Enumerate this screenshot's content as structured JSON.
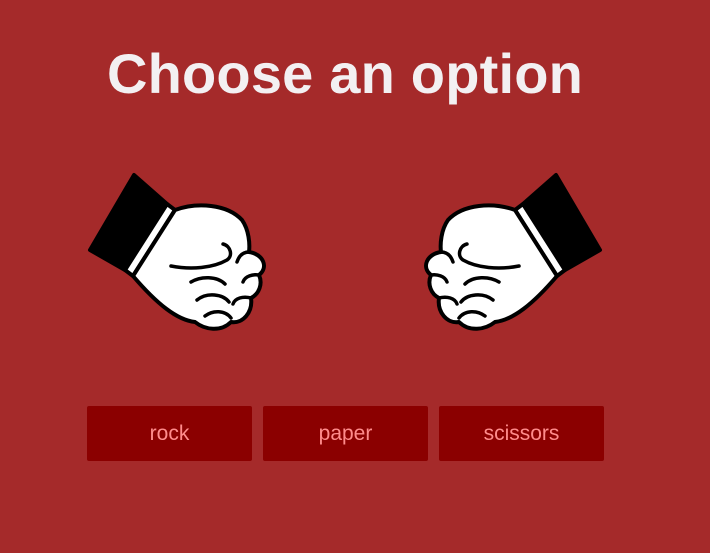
{
  "header": {
    "title": "Choose an option"
  },
  "hands": {
    "player": {
      "icon": "fist-icon",
      "gesture": "rock"
    },
    "computer": {
      "icon": "fist-icon",
      "gesture": "rock"
    }
  },
  "choices": [
    {
      "label": "rock"
    },
    {
      "label": "paper"
    },
    {
      "label": "scissors"
    }
  ],
  "colors": {
    "background": "#a52a2a",
    "title": "#f3f0f2",
    "button_bg": "#8b0000",
    "button_text": "#ff8c8c"
  }
}
